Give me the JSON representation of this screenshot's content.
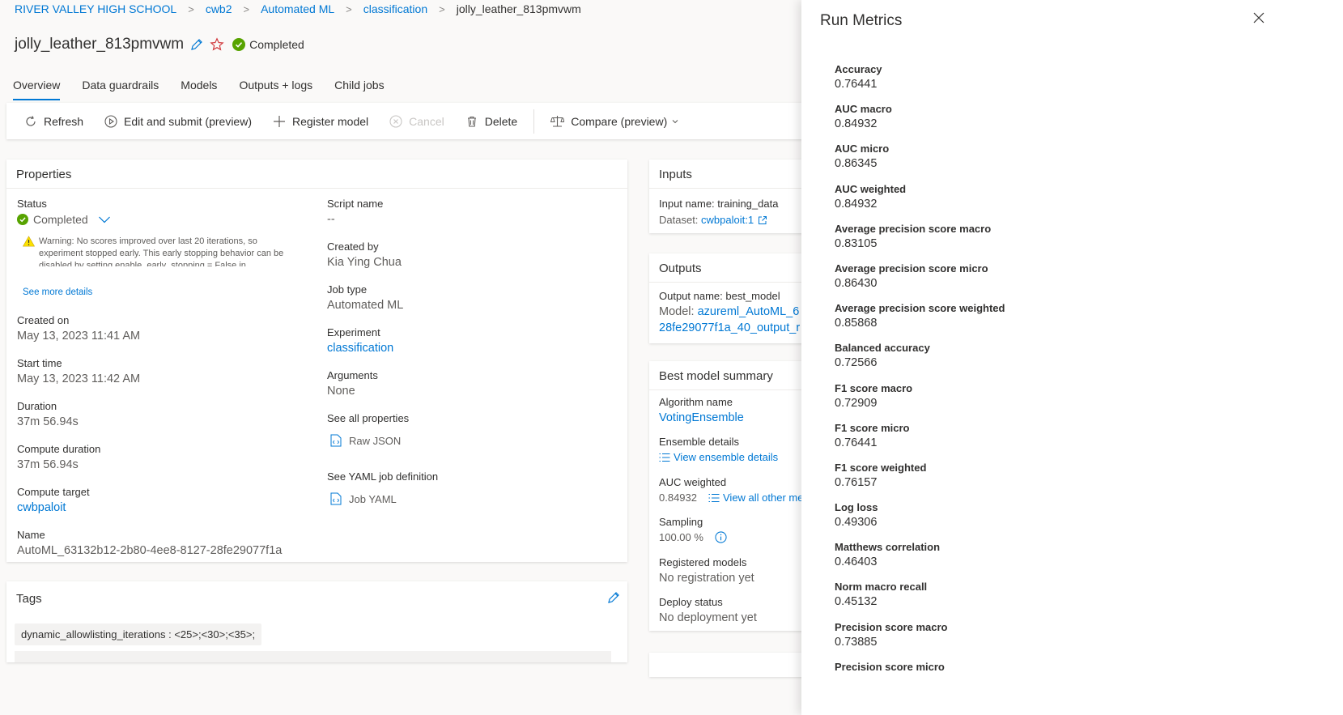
{
  "breadcrumb": [
    "RIVER VALLEY HIGH SCHOOL",
    "cwb2",
    "Automated ML",
    "classification",
    "jolly_leather_813pmvwm"
  ],
  "header": {
    "title": "jolly_leather_813pmvwm",
    "status": "Completed"
  },
  "tabs": [
    "Overview",
    "Data guardrails",
    "Models",
    "Outputs + logs",
    "Child jobs"
  ],
  "toolbar": {
    "refresh": "Refresh",
    "edit_submit": "Edit and submit (preview)",
    "register": "Register model",
    "cancel": "Cancel",
    "delete": "Delete",
    "compare": "Compare (preview)"
  },
  "properties": {
    "title": "Properties",
    "status_label": "Status",
    "status_value": "Completed",
    "warning_prefix": "Warning:",
    "warning_text": "No scores improved over last 20 iterations, so experiment stopped early. This early stopping behavior can be disabled by setting enable_early_stopping = False in",
    "see_more": "See more details",
    "created_on_label": "Created on",
    "created_on": "May 13, 2023 11:41 AM",
    "start_time_label": "Start time",
    "start_time": "May 13, 2023 11:42 AM",
    "duration_label": "Duration",
    "duration": "37m 56.94s",
    "compute_duration_label": "Compute duration",
    "compute_duration": "37m 56.94s",
    "compute_target_label": "Compute target",
    "compute_target": "cwbpaloit",
    "name_label": "Name",
    "name": "AutoML_63132b12-2b80-4ee8-8127-28fe29077f1a",
    "script_name_label": "Script name",
    "script_name": "--",
    "created_by_label": "Created by",
    "created_by": "Kia Ying Chua",
    "job_type_label": "Job type",
    "job_type": "Automated ML",
    "experiment_label": "Experiment",
    "experiment": "classification",
    "arguments_label": "Arguments",
    "arguments": "None",
    "see_all_label": "See all properties",
    "raw_json": "Raw JSON",
    "see_yaml_label": "See YAML job definition",
    "job_yaml": "Job YAML"
  },
  "tags": {
    "title": "Tags",
    "chip": "dynamic_allowlisting_iterations : <25>;<30>;<35>;"
  },
  "inputs": {
    "title": "Inputs",
    "input_name": "Input name: training_data",
    "dataset_prefix": "Dataset:",
    "dataset": "cwbpaloit:1"
  },
  "outputs": {
    "title": "Outputs",
    "output_name": "Output name: best_model",
    "model_prefix": "Model:",
    "model_line1": "azureml_AutoML_6",
    "model_line2": "28fe29077f1a_40_output_r"
  },
  "best_model": {
    "title": "Best model summary",
    "algorithm_label": "Algorithm name",
    "algorithm": "VotingEnsemble",
    "ensemble_label": "Ensemble details",
    "ensemble_link": "View ensemble details",
    "auc_label": "AUC weighted",
    "auc_value": "0.84932",
    "auc_link": "View all other me",
    "sampling_label": "Sampling",
    "sampling_value": "100.00 %",
    "registered_label": "Registered models",
    "registered_value": "No registration yet",
    "deploy_label": "Deploy status",
    "deploy_value": "No deployment yet"
  },
  "metrics_panel": {
    "title": "Run Metrics",
    "metrics": [
      {
        "name": "Accuracy",
        "value": "0.76441"
      },
      {
        "name": "AUC macro",
        "value": "0.84932"
      },
      {
        "name": "AUC micro",
        "value": "0.86345"
      },
      {
        "name": "AUC weighted",
        "value": "0.84932"
      },
      {
        "name": "Average precision score macro",
        "value": "0.83105"
      },
      {
        "name": "Average precision score micro",
        "value": "0.86430"
      },
      {
        "name": "Average precision score weighted",
        "value": "0.85868"
      },
      {
        "name": "Balanced accuracy",
        "value": "0.72566"
      },
      {
        "name": "F1 score macro",
        "value": "0.72909"
      },
      {
        "name": "F1 score micro",
        "value": "0.76441"
      },
      {
        "name": "F1 score weighted",
        "value": "0.76157"
      },
      {
        "name": "Log loss",
        "value": "0.49306"
      },
      {
        "name": "Matthews correlation",
        "value": "0.46403"
      },
      {
        "name": "Norm macro recall",
        "value": "0.45132"
      },
      {
        "name": "Precision score macro",
        "value": "0.73885"
      },
      {
        "name": "Precision score micro",
        "value": ""
      }
    ]
  },
  "colors": {
    "accent": "#0078d4",
    "success": "#57a300",
    "warning": "#fce100"
  }
}
